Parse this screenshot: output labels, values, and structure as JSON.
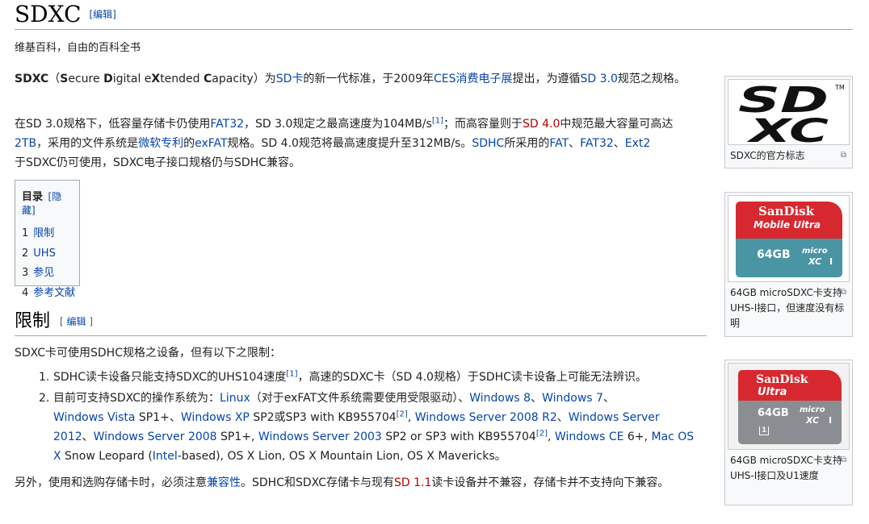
{
  "title": "SDXC",
  "title_edit": "[编辑]",
  "tagline": "维基百科，自由的百科全书",
  "intro": {
    "term": "SDXC",
    "open": "（",
    "acronym": [
      "S",
      "ecure ",
      "D",
      "igital e",
      "X",
      "tended ",
      "C",
      "apacity"
    ],
    "close": "）为",
    "sd_link": "SD卡",
    "t1": "的新一代标准，于2009年",
    "ces_link": "CES消费电子展",
    "t2": "提出，为遵循",
    "sd30_link": "SD 3.0",
    "t3": "规范之规格。"
  },
  "para2": {
    "t1": "在SD 3.0规格下，低容量存储卡仍使用",
    "fat32": "FAT32",
    "t2": "，SD 3.0规定之最高速度为104MB/s",
    "ref1": "[1]",
    "t3": "；而高容量则于",
    "sd40": "SD 4.0",
    "t4": "中规范最大容量可高达",
    "tb": "2TB",
    "t5": "，采用的文件系统是",
    "ms": "微软专利",
    "t6": "的",
    "exfat": "exFAT",
    "t7": "规格。SD 4.0规范将最高速度提升至312MB/s。",
    "sdhc": "SDHC",
    "t8": "所采用的",
    "fat": "FAT",
    "sep1": "、",
    "fat32b": "FAT32",
    "sep2": "、",
    "ext2": "Ext2",
    "t9": "于SDXC仍可使用，SDXC电子接口规格仍与SDHC兼容。"
  },
  "toc": {
    "heading": "目录",
    "hide": "[隐藏]",
    "items": [
      {
        "num": "1",
        "label": "限制"
      },
      {
        "num": "2",
        "label": "UHS"
      },
      {
        "num": "3",
        "label": "参见"
      },
      {
        "num": "4",
        "label": "参考文献"
      }
    ]
  },
  "section": {
    "title": "限制",
    "edit_open": "[ ",
    "edit_label": "编辑",
    "edit_close": " ]",
    "intro": "SDXC卡可使用SDHC规格之设备，但有以下之限制：",
    "item1": {
      "num": "1.",
      "t1": "SDHC读卡设备只能支持SDXC的UHS104速度",
      "ref": "[1]",
      "t2": "，高速的SDXC卡（SD 4.0规格）于SDHC读卡设备上可能无法辨识。"
    },
    "item2": {
      "num": "2.",
      "t1": "目前可支持SDXC的操作系统为：",
      "linux": "Linux",
      "t2": "（对于exFAT文件系统需要使用受限驱动）、",
      "win8": "Windows 8",
      "s1": "、",
      "win7": "Windows 7",
      "s2": "、",
      "vista": "Windows Vista",
      "t3": " SP1+、",
      "xp": "Windows XP",
      "t4": " SP2或SP3 with KB955704",
      "ref2a": "[2]",
      "s3": ", ",
      "ws2008r2": "Windows Server 2008 R2",
      "s4": "、",
      "ws2012": "Windows Server 2012",
      "s5": "、",
      "ws2008": "Windows Server 2008",
      "t5": " SP1+, ",
      "ws2003": "Windows Server 2003",
      "t6": " SP2 or SP3 with KB955704",
      "ref2b": "[2]",
      "s6": ", ",
      "wince": "Windows CE",
      "t7": " 6+, ",
      "macosx": "Mac OS X",
      "t8": " Snow Leopard (",
      "intel": "Intel",
      "t9": "-based), OS X Lion, OS X Mountain Lion, OS X Mavericks。"
    },
    "outro": {
      "t1": "另外，使用和选购存储卡时，必须注意",
      "compat": "兼容性",
      "t2": "。SDHC和SDXC存储卡与现有",
      "sd11": "SD 1.1",
      "t3": "读卡设备并不兼容，存储卡并不支持向下兼容。"
    }
  },
  "thumbs": [
    {
      "caption": "SDXC的官方标志",
      "logo_top": "SD",
      "logo_bottom": "XC",
      "tm": "TM"
    },
    {
      "caption": "64GB microSDXC卡支持UHS-I接口，但速度没有标明",
      "brand": "SanDisk",
      "model": "Mobile Ultra",
      "capacity": "64GB",
      "micro": "micro",
      "xc": "XC",
      "uhs": "I"
    },
    {
      "caption": "64GB microSDXC卡支持UHS-I接口及U1速度",
      "brand": "SanDisk",
      "model": "Ultra",
      "capacity": "64GB",
      "micro": "micro",
      "xc": "XC",
      "uhs": "I",
      "u1": "1"
    }
  ],
  "colors": {
    "link": "#0645ad",
    "redlink": "#ba0000",
    "sandisk_red": "#d8282f",
    "teal": "#4a95a4",
    "gray": "#8a8d92"
  }
}
